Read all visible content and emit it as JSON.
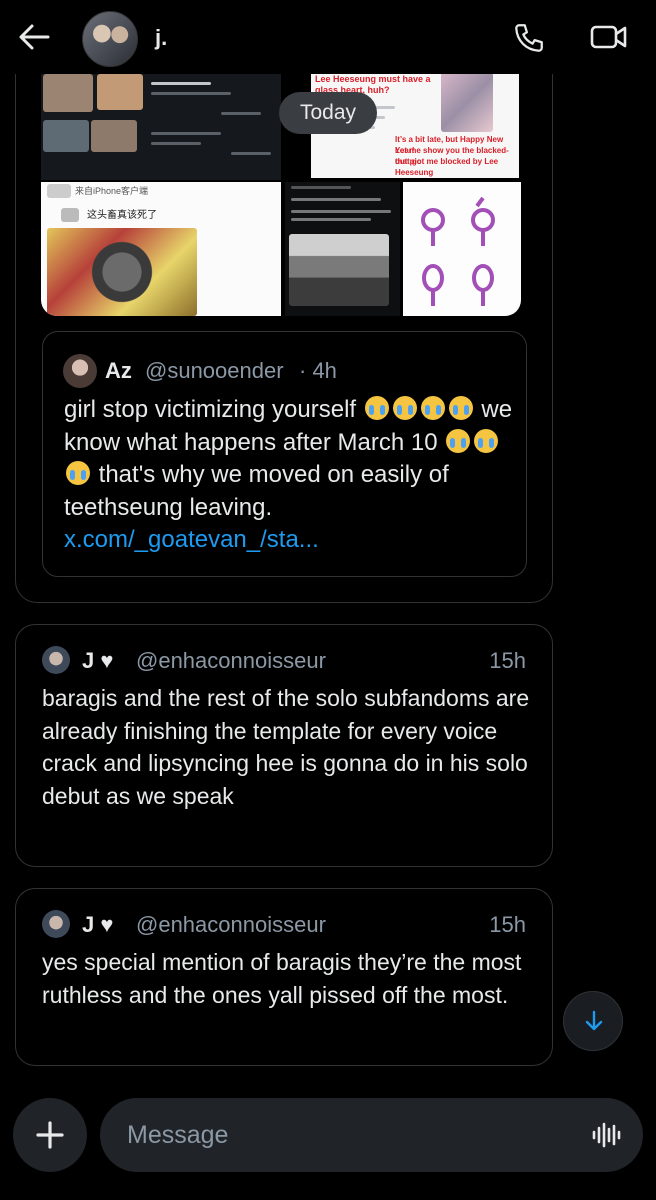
{
  "header": {
    "title": "j.",
    "icons": [
      "back-arrow-icon",
      "phone-icon",
      "video-icon"
    ]
  },
  "date_pill": "Today",
  "shared_post": {
    "media_text": {
      "t2_line1": "Lee Heeseung must have a glass heart, huh?",
      "t2_red1": "It’s a bit late, but Happy New Year!",
      "t2_red2": "Let me show you the blacked-out pic",
      "t2_red3": "that got me blocked by Lee Heeseung",
      "t3_header": "来自iPhone客户端",
      "t3_caption": "这头畜真该死了"
    },
    "quote": {
      "name": "Az",
      "handle": "@sunooender",
      "time": "· 4h",
      "text_before": "girl stop victimizing yourself ",
      "text_mid1": " we know what happens after March 10 ",
      "text_mid2": " that's why we moved on easily of teethseung leaving. ",
      "link": "x.com/_goatevan_/sta..."
    }
  },
  "messages": [
    {
      "name": "J",
      "handle": "@enhaconnoisseur",
      "time": "15h",
      "text": "baragis and the rest of the solo subfandoms are already finishing the template for every voice crack and lipsyncing hee is gonna do in his solo debut as we speak"
    },
    {
      "name": "J",
      "handle": "@enhaconnoisseur",
      "time": "15h",
      "text": "yes special mention of baragis they’re the most ruthless and the ones yall pissed off the most."
    }
  ],
  "composer": {
    "placeholder": "Message"
  },
  "colors": {
    "accent": "#1d9bf0",
    "muted": "#8b98a5",
    "border": "#2f3336",
    "bg": "#000000"
  }
}
